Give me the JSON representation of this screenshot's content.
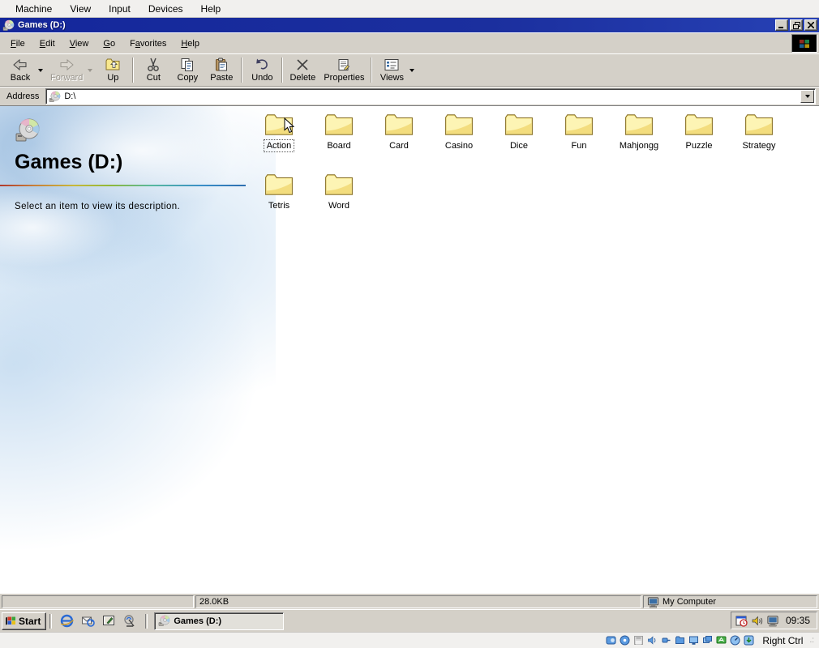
{
  "colors": {
    "titlebar": "#1b2f9e",
    "window_face": "#d4d0c8",
    "folder_yellow": "#f6e389",
    "webview_blue": "#a8c8e8"
  },
  "vbox_menubar": {
    "items": [
      "Machine",
      "View",
      "Input",
      "Devices",
      "Help"
    ]
  },
  "window": {
    "title": "Games (D:)"
  },
  "menubar": {
    "items": [
      {
        "pre": "",
        "u": "F",
        "post": "ile"
      },
      {
        "pre": "",
        "u": "E",
        "post": "dit"
      },
      {
        "pre": "",
        "u": "V",
        "post": "iew"
      },
      {
        "pre": "",
        "u": "G",
        "post": "o"
      },
      {
        "pre": "F",
        "u": "a",
        "post": "vorites"
      },
      {
        "pre": "",
        "u": "H",
        "post": "elp"
      }
    ]
  },
  "toolbar": {
    "back": "Back",
    "forward": "Forward",
    "up": "Up",
    "cut": "Cut",
    "copy": "Copy",
    "paste": "Paste",
    "undo": "Undo",
    "delete": "Delete",
    "properties": "Properties",
    "views": "Views"
  },
  "addressbar": {
    "label": "Address",
    "value": "D:\\"
  },
  "webview": {
    "title": "Games (D:)",
    "description": "Select an item to view its description."
  },
  "folders": {
    "items": [
      {
        "label": "Action",
        "selected": true
      },
      {
        "label": "Board"
      },
      {
        "label": "Card"
      },
      {
        "label": "Casino"
      },
      {
        "label": "Dice"
      },
      {
        "label": "Fun"
      },
      {
        "label": "Mahjongg"
      },
      {
        "label": "Puzzle"
      },
      {
        "label": "Strategy"
      },
      {
        "label": "Tetris"
      },
      {
        "label": "Word"
      }
    ]
  },
  "statusbar": {
    "size": "28.0KB",
    "zone": "My Computer"
  },
  "taskbar": {
    "start": "Start",
    "task": "Games (D:)",
    "clock": "09:35",
    "quick_launch_icons": [
      "internet-explorer",
      "outlook-express",
      "show-desktop",
      "channels"
    ],
    "tray_icons": [
      "task-scheduler",
      "volume",
      "display"
    ]
  },
  "vbox_statusbar": {
    "host_key": "Right Ctrl",
    "icons": [
      "hard-disk",
      "optical-disc",
      "floppy",
      "audio",
      "usb",
      "shared-folders",
      "display",
      "recording",
      "network",
      "features",
      "keyboard-capture"
    ]
  }
}
